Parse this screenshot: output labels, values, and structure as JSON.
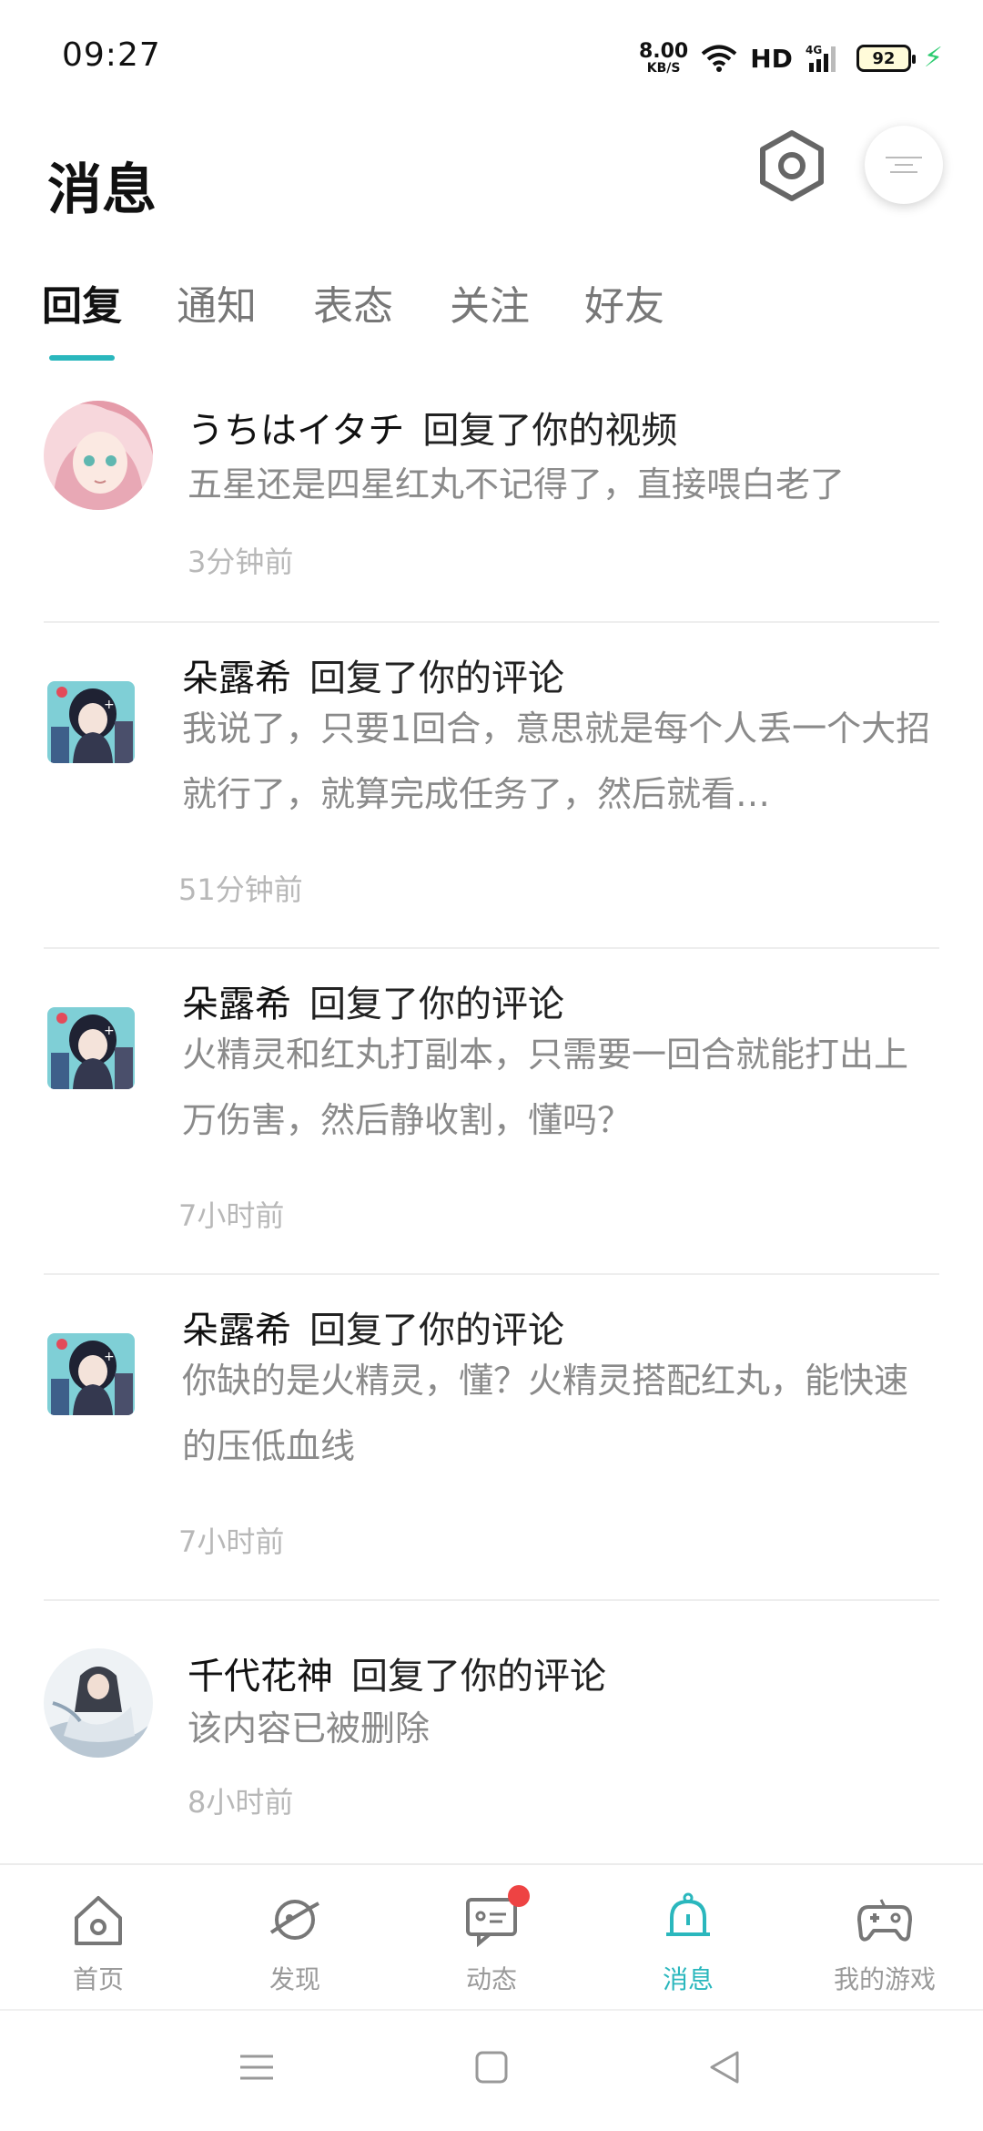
{
  "status_bar": {
    "time": "09:27",
    "net_speed_value": "8.00",
    "net_speed_unit": "KB/S",
    "hd_label": "HD",
    "network": "4G",
    "battery_level": "92",
    "icons": [
      "wifi-icon",
      "signal-icon",
      "battery-icon",
      "charging-icon"
    ]
  },
  "header": {
    "title": "消息",
    "settings_icon": "hexagon-gear-icon"
  },
  "tabs": [
    {
      "label": "回复",
      "active": true
    },
    {
      "label": "通知",
      "active": false
    },
    {
      "label": "表态",
      "active": false
    },
    {
      "label": "关注",
      "active": false
    },
    {
      "label": "好友",
      "active": false
    }
  ],
  "messages": [
    {
      "user": "うちはイタチ",
      "action": "回复了你的视频",
      "body": "五星还是四星红丸不记得了，直接喂白老了",
      "time": "3分钟前"
    },
    {
      "user": "朵露希",
      "action": "回复了你的评论",
      "body": "我说了，只要1回合，意思就是每个人丢一个大招就行了，就算完成任务了，然后就看…",
      "time": "51分钟前"
    },
    {
      "user": "朵露希",
      "action": "回复了你的评论",
      "body": "火精灵和红丸打副本，只需要一回合就能打出上万伤害，然后静收割，懂吗？",
      "time": "7小时前"
    },
    {
      "user": "朵露希",
      "action": "回复了你的评论",
      "body": "你缺的是火精灵，懂？火精灵搭配红丸，能快速的压低血线",
      "time": "7小时前"
    },
    {
      "user": "千代花神",
      "action": "回复了你的评论",
      "body": "该内容已被删除",
      "time": "8小时前"
    }
  ],
  "bottom_nav": [
    {
      "label": "首页",
      "icon": "home-icon",
      "active": false
    },
    {
      "label": "发现",
      "icon": "planet-icon",
      "active": false
    },
    {
      "label": "动态",
      "icon": "chat-icon",
      "active": false,
      "badge": true
    },
    {
      "label": "消息",
      "icon": "bell-icon",
      "active": true
    },
    {
      "label": "我的游戏",
      "icon": "gamepad-icon",
      "active": false
    }
  ],
  "colors": {
    "accent": "#2ab7bd",
    "badge": "#ee4343",
    "muted_text": "#8a8a8a",
    "time_text": "#b8b8b8"
  }
}
